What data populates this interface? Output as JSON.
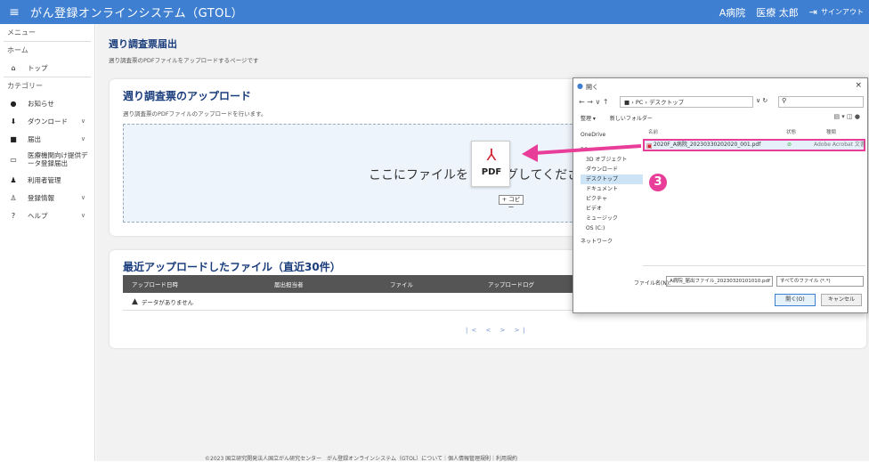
{
  "header": {
    "menu_icon": "≡",
    "title": "がん登録オンラインシステム（GTOL）",
    "hospital": "A病院",
    "user": "医療 太郎",
    "signout_icon": "⇥",
    "signout": "サインアウト",
    "color": "#3f7fd1"
  },
  "sidebar": {
    "menu_label": "メニュー",
    "home_label": "ホーム",
    "category_label": "カテゴリー",
    "items": [
      {
        "icon": "home-icon",
        "glyph": "⌂",
        "label": "トップ",
        "chevron": ""
      },
      {
        "icon": "info-icon",
        "glyph": "●",
        "label": "お知らせ",
        "chevron": ""
      },
      {
        "icon": "download-icon",
        "glyph": "⬇",
        "label": "ダウンロード",
        "chevron": "∨"
      },
      {
        "icon": "file-icon",
        "glyph": "■",
        "label": "届出",
        "chevron": "∨"
      },
      {
        "icon": "monitor-icon",
        "glyph": "▭",
        "label": "医療機関向け提供デ\nータ登録届出",
        "chevron": ""
      },
      {
        "icon": "users-icon",
        "glyph": "♟",
        "label": "利用者管理",
        "chevron": ""
      },
      {
        "icon": "user-settings-icon",
        "glyph": "♙",
        "label": "登録情報",
        "chevron": "∨"
      },
      {
        "icon": "help-icon",
        "glyph": "?",
        "label": "ヘルプ",
        "chevron": "∨"
      }
    ]
  },
  "page": {
    "title": "週り調査票届出",
    "description": "週り調査票のPDFファイルをアップロードするページです"
  },
  "upload": {
    "title": "週り調査票のアップロード",
    "description": "週り調査票のPDFファイルのアップロードを行います。",
    "drop_text": "ここにファイルをドラッグしてください",
    "drag_file_label": "PDF",
    "drag_file_glyph": "⅄",
    "copy_tag": "+ コピー"
  },
  "recent": {
    "title": "最近アップロードしたファイル（直近30件）",
    "columns": [
      "アップロード日時",
      "届出担当者",
      "ファイル",
      "アップロードログ"
    ],
    "no_data_icon": "▲",
    "no_data": "データがありません",
    "pager": "|< < > >|"
  },
  "dialog": {
    "title_icon": "●",
    "title": "開く",
    "close": "×",
    "nav": "← → ∨ ↑",
    "path": "■ › PC › デスクトップ",
    "path_controls": "∨ ↻",
    "search_icon": "⚲",
    "organize": "整理 ▾",
    "new_folder": "新しいフォルダー",
    "view_controls": "▤ ▾ ◫ ●",
    "tree": [
      "OneDrive",
      "PC",
      "3D オブジェクト",
      "ダウンロード",
      "デスクトップ",
      "ドキュメント",
      "ピクチャ",
      "ビデオ",
      "ミュージック",
      "OS (C:)",
      "ネットワーク"
    ],
    "columns": [
      "名前",
      "状態",
      "種類"
    ],
    "file_name": "2020F_A病院_20230330202020_001.pdf",
    "file_status": "⊘",
    "file_app": "Adobe Acrobat 文書",
    "file_name_label": "ファイル名(N):",
    "file_name_value": "A病院_届出ファイル_20230320101010.pdf",
    "file_type": "すべてのファイル (*.*)",
    "open_button": "開く(O)",
    "cancel_button": "キャンセル"
  },
  "annotation": {
    "step": "3",
    "color": "#e83e9a"
  },
  "footer": "©2023 国立研究開発法人国立がん研究センター　がん登録オンラインシステム（GTOL）について｜個人情報管理規則｜利用規約"
}
